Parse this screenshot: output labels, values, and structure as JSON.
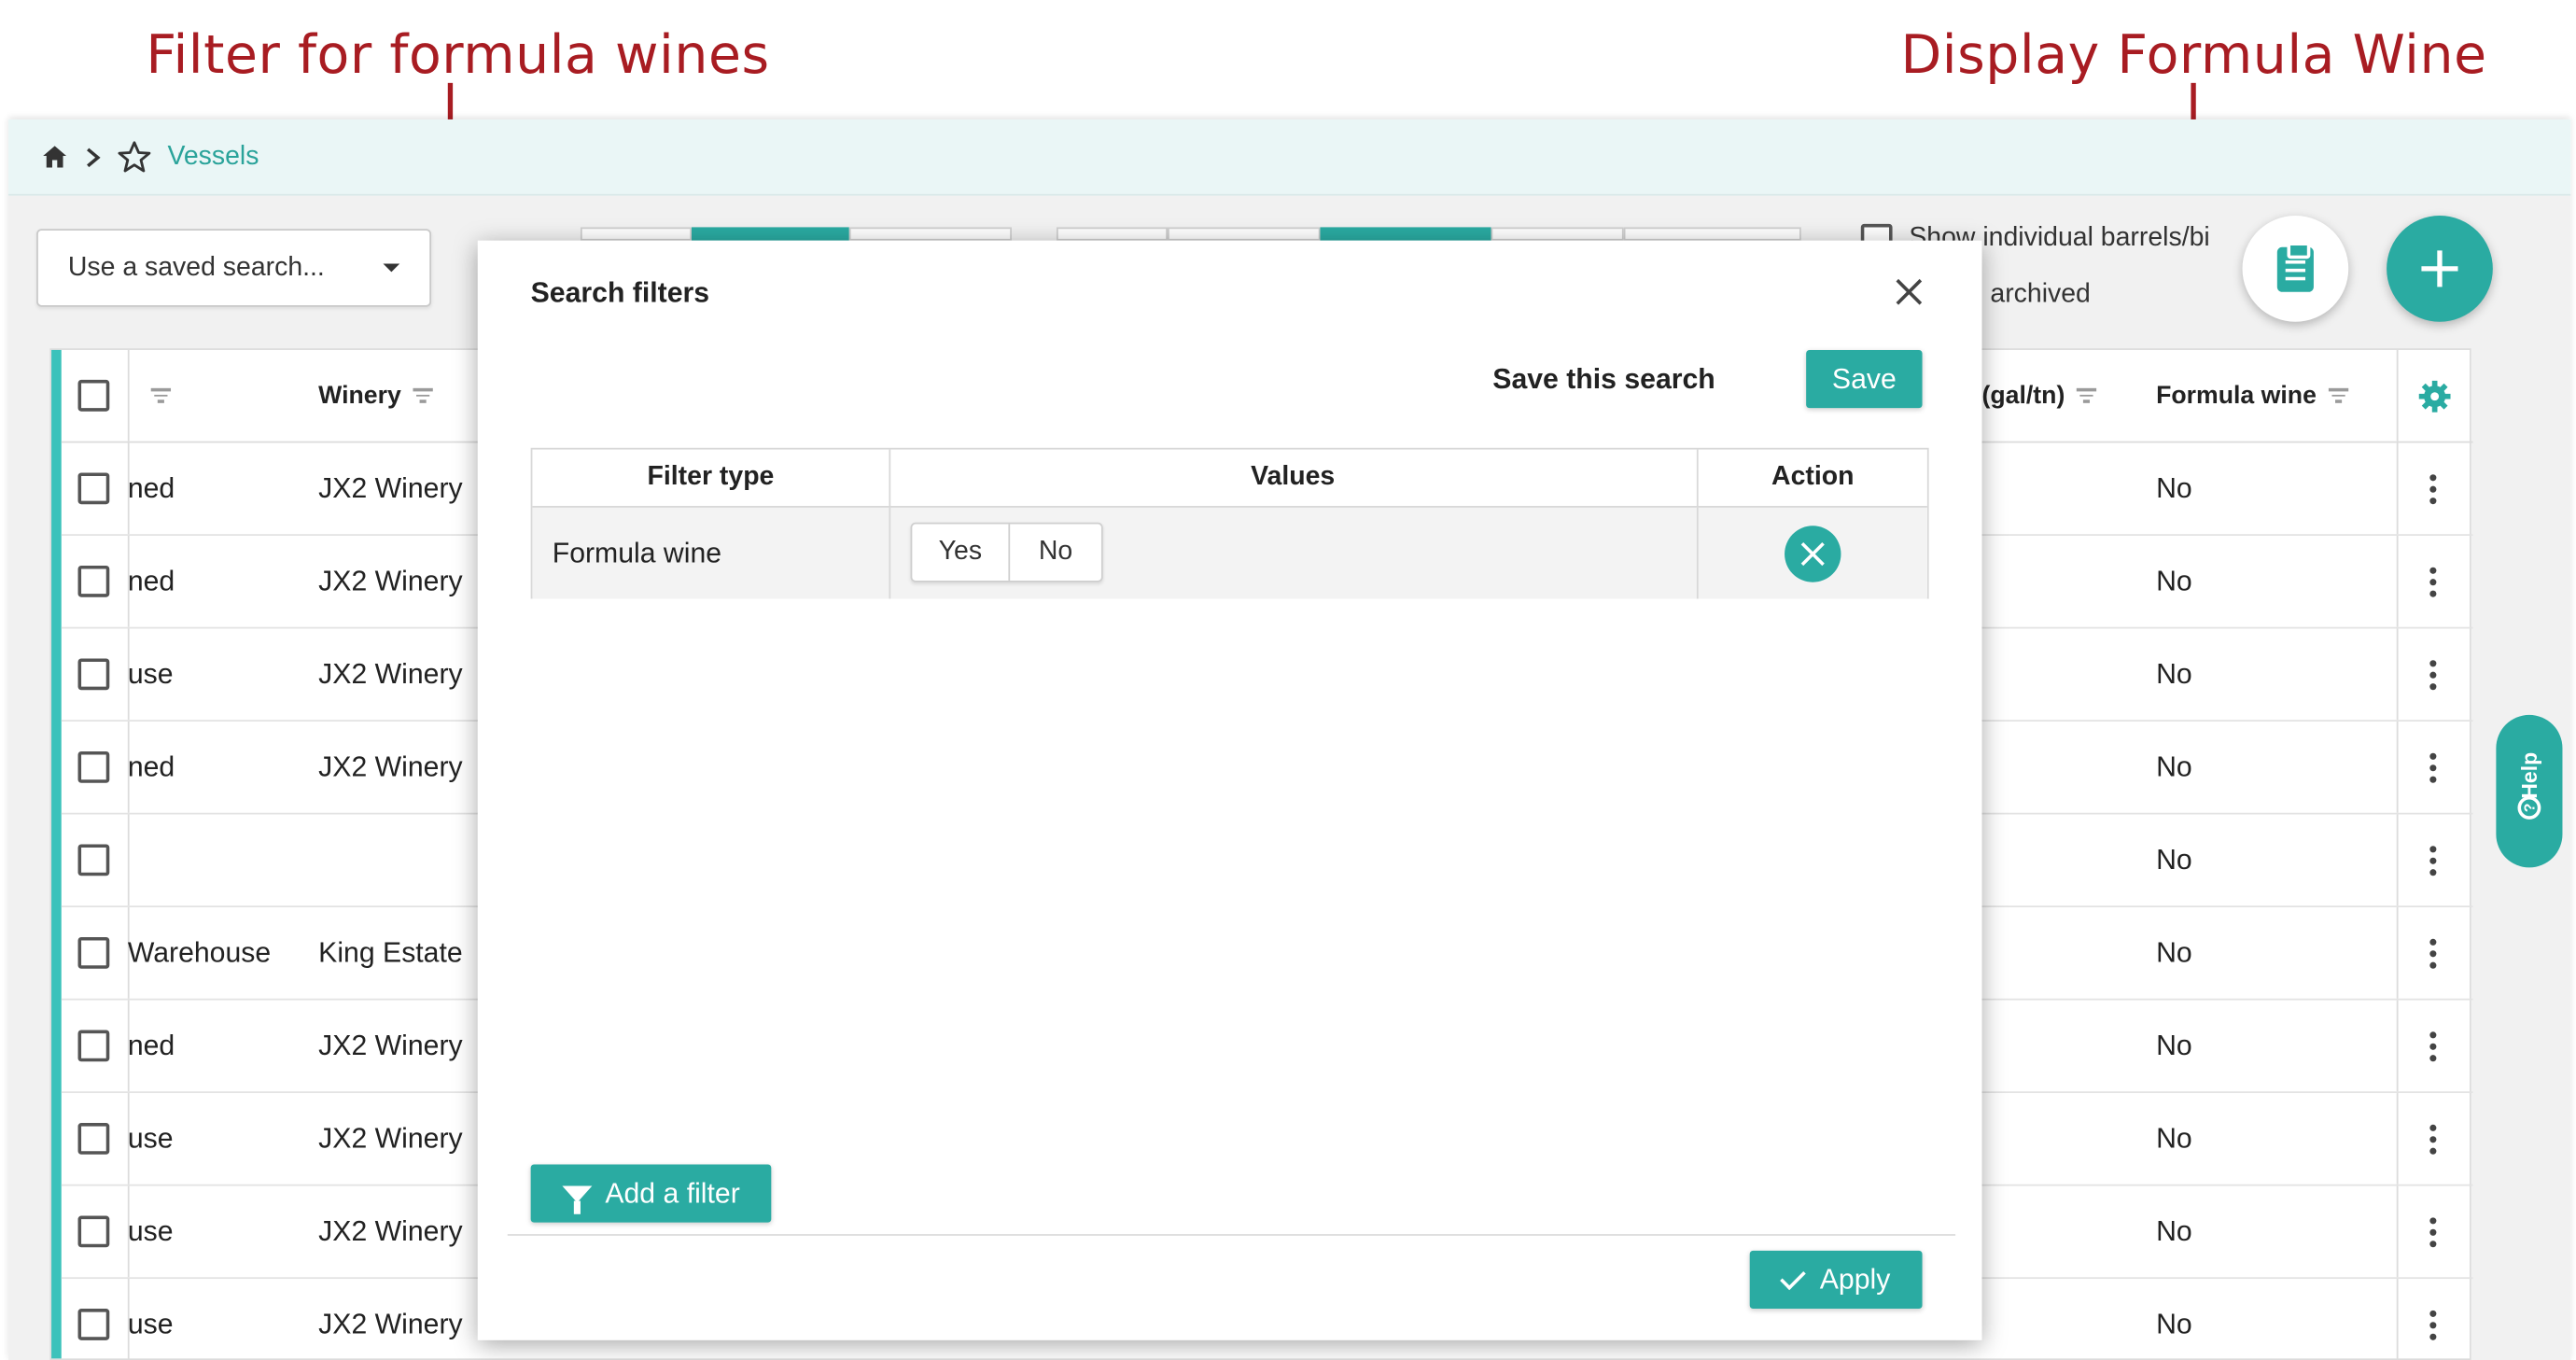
{
  "annotations": {
    "left": "Filter for formula wines",
    "right": "Display Formula Wine"
  },
  "breadcrumb": {
    "home_icon": "home-icon",
    "star_icon": "star-outline-icon",
    "current": "Vessels"
  },
  "toolbar": {
    "saved_search_placeholder": "Use a saved search...",
    "show_individual_label": "Show individual barrels/bi",
    "archived_label": "archived"
  },
  "table": {
    "headers": {
      "col2": "Winery",
      "col_gal": "(gal/tn)",
      "col_formula": "Formula wine"
    },
    "rows": [
      {
        "location": "ned",
        "winery": "JX2 Winery",
        "formula": "No"
      },
      {
        "location": "ned",
        "winery": "JX2 Winery",
        "formula": "No"
      },
      {
        "location": "use",
        "winery": "JX2 Winery",
        "formula": "No"
      },
      {
        "location": "ned",
        "winery": "JX2 Winery",
        "formula": "No"
      },
      {
        "location": "",
        "winery": "",
        "formula": "No"
      },
      {
        "location": "Warehouse",
        "winery": "King Estate",
        "formula": "No"
      },
      {
        "location": "ned",
        "winery": "JX2 Winery",
        "formula": "No"
      },
      {
        "location": "use",
        "winery": "JX2 Winery",
        "formula": "No"
      },
      {
        "location": "use",
        "winery": "JX2 Winery",
        "formula": "No"
      },
      {
        "location": "use",
        "winery": "JX2 Winery",
        "formula": "No"
      }
    ]
  },
  "help": {
    "label": "Help"
  },
  "modal": {
    "title": "Search filters",
    "save_search_label": "Save this search",
    "save_button": "Save",
    "columns": {
      "filter_type": "Filter type",
      "values": "Values",
      "action": "Action"
    },
    "filter": {
      "type": "Formula wine",
      "yes": "Yes",
      "no": "No"
    },
    "add_filter": "Add a filter",
    "apply": "Apply"
  },
  "colors": {
    "accent": "#2aaba2",
    "annotation": "#a81c22",
    "breadcrumb_bg": "#eaf6f6"
  }
}
